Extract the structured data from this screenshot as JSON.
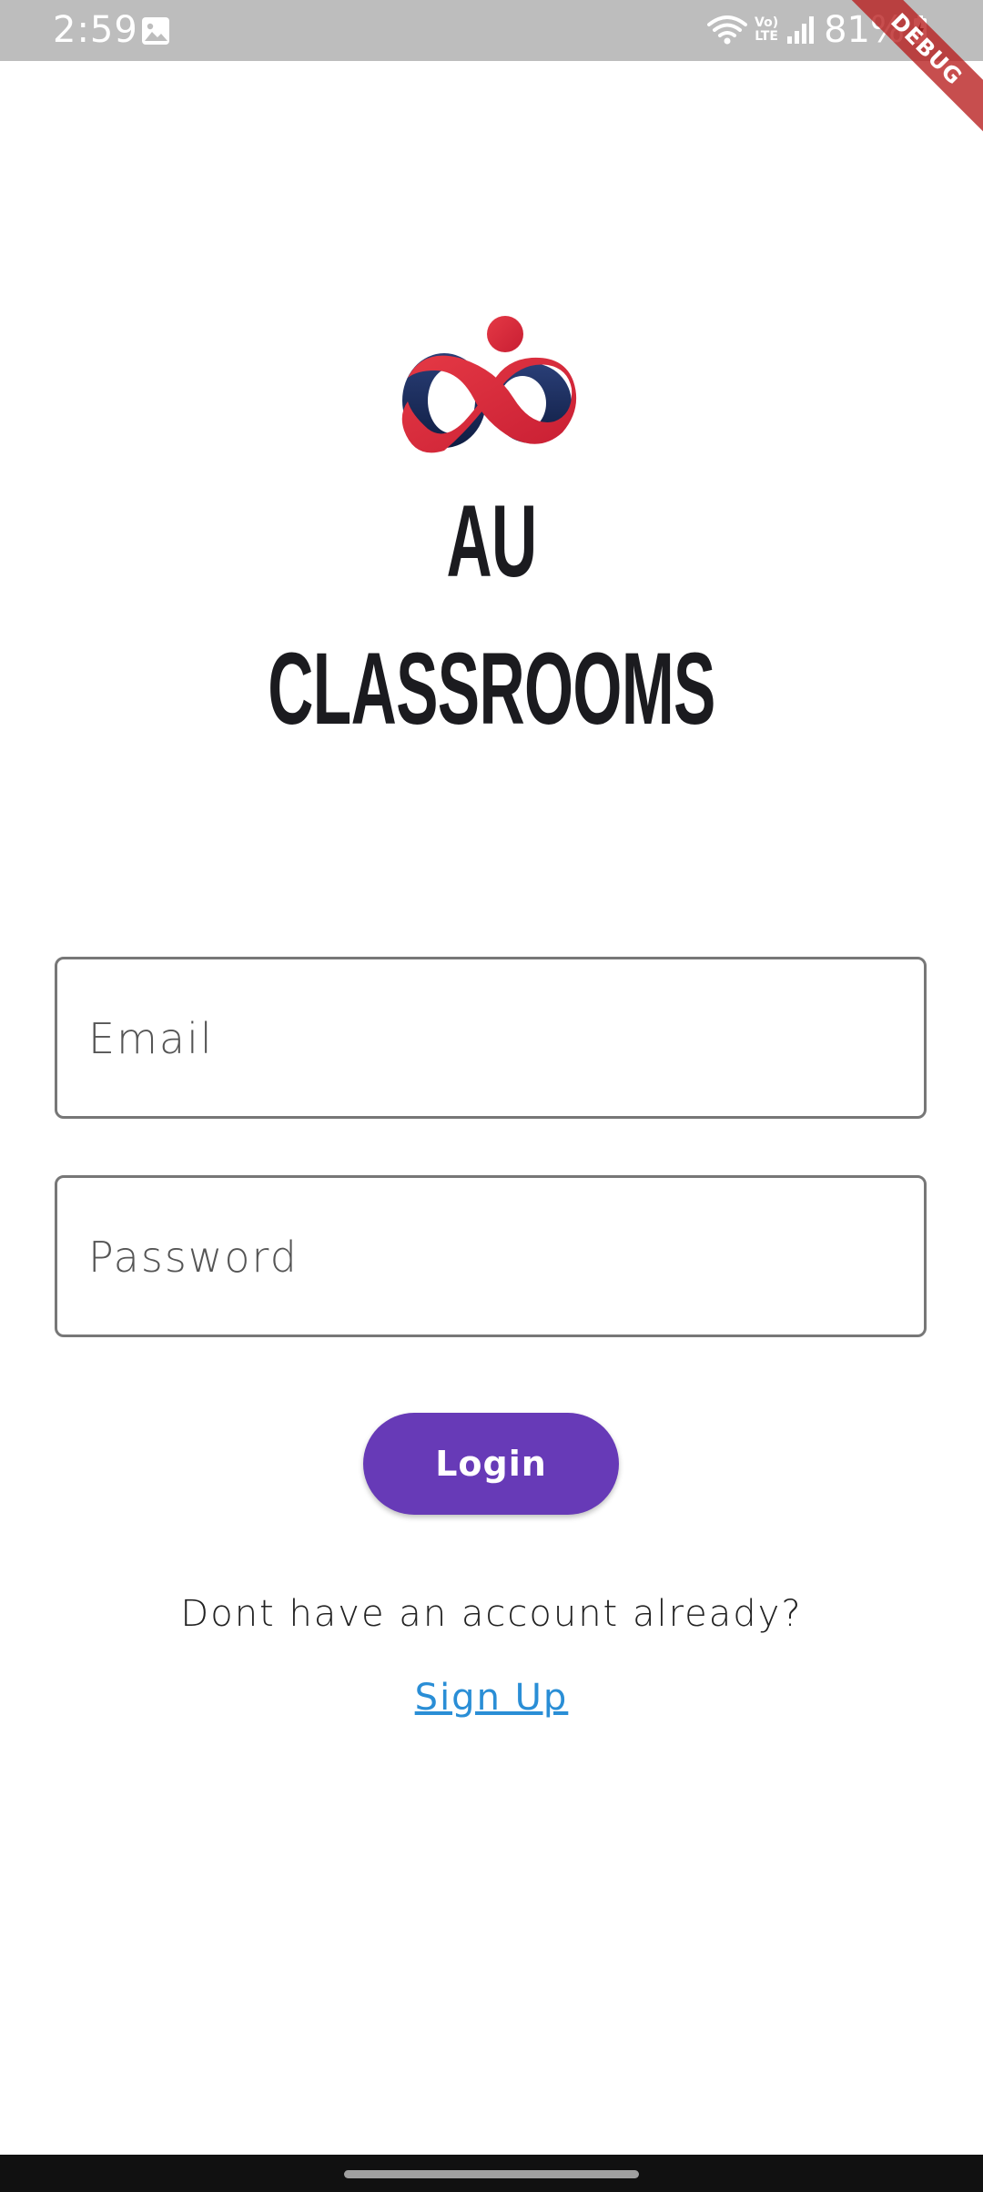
{
  "status_bar": {
    "time": "2:59",
    "volte_top": "Vo)",
    "volte_bottom": "LTE",
    "battery": "81%"
  },
  "debug_banner": {
    "label": "DEBUG"
  },
  "app": {
    "title_line1": "AU",
    "title_line2": "CLASSROOMS"
  },
  "form": {
    "email_placeholder": "Email",
    "password_placeholder": "Password",
    "login_label": "Login"
  },
  "footer": {
    "prompt": "Dont have an account already?",
    "signup_label": "Sign Up"
  },
  "colors": {
    "primary": "#673ab7",
    "link": "#2a8ed6",
    "logo_red": "#d6283a",
    "logo_navy": "#1c2f5e",
    "status_bar": "#bdbdbd"
  }
}
